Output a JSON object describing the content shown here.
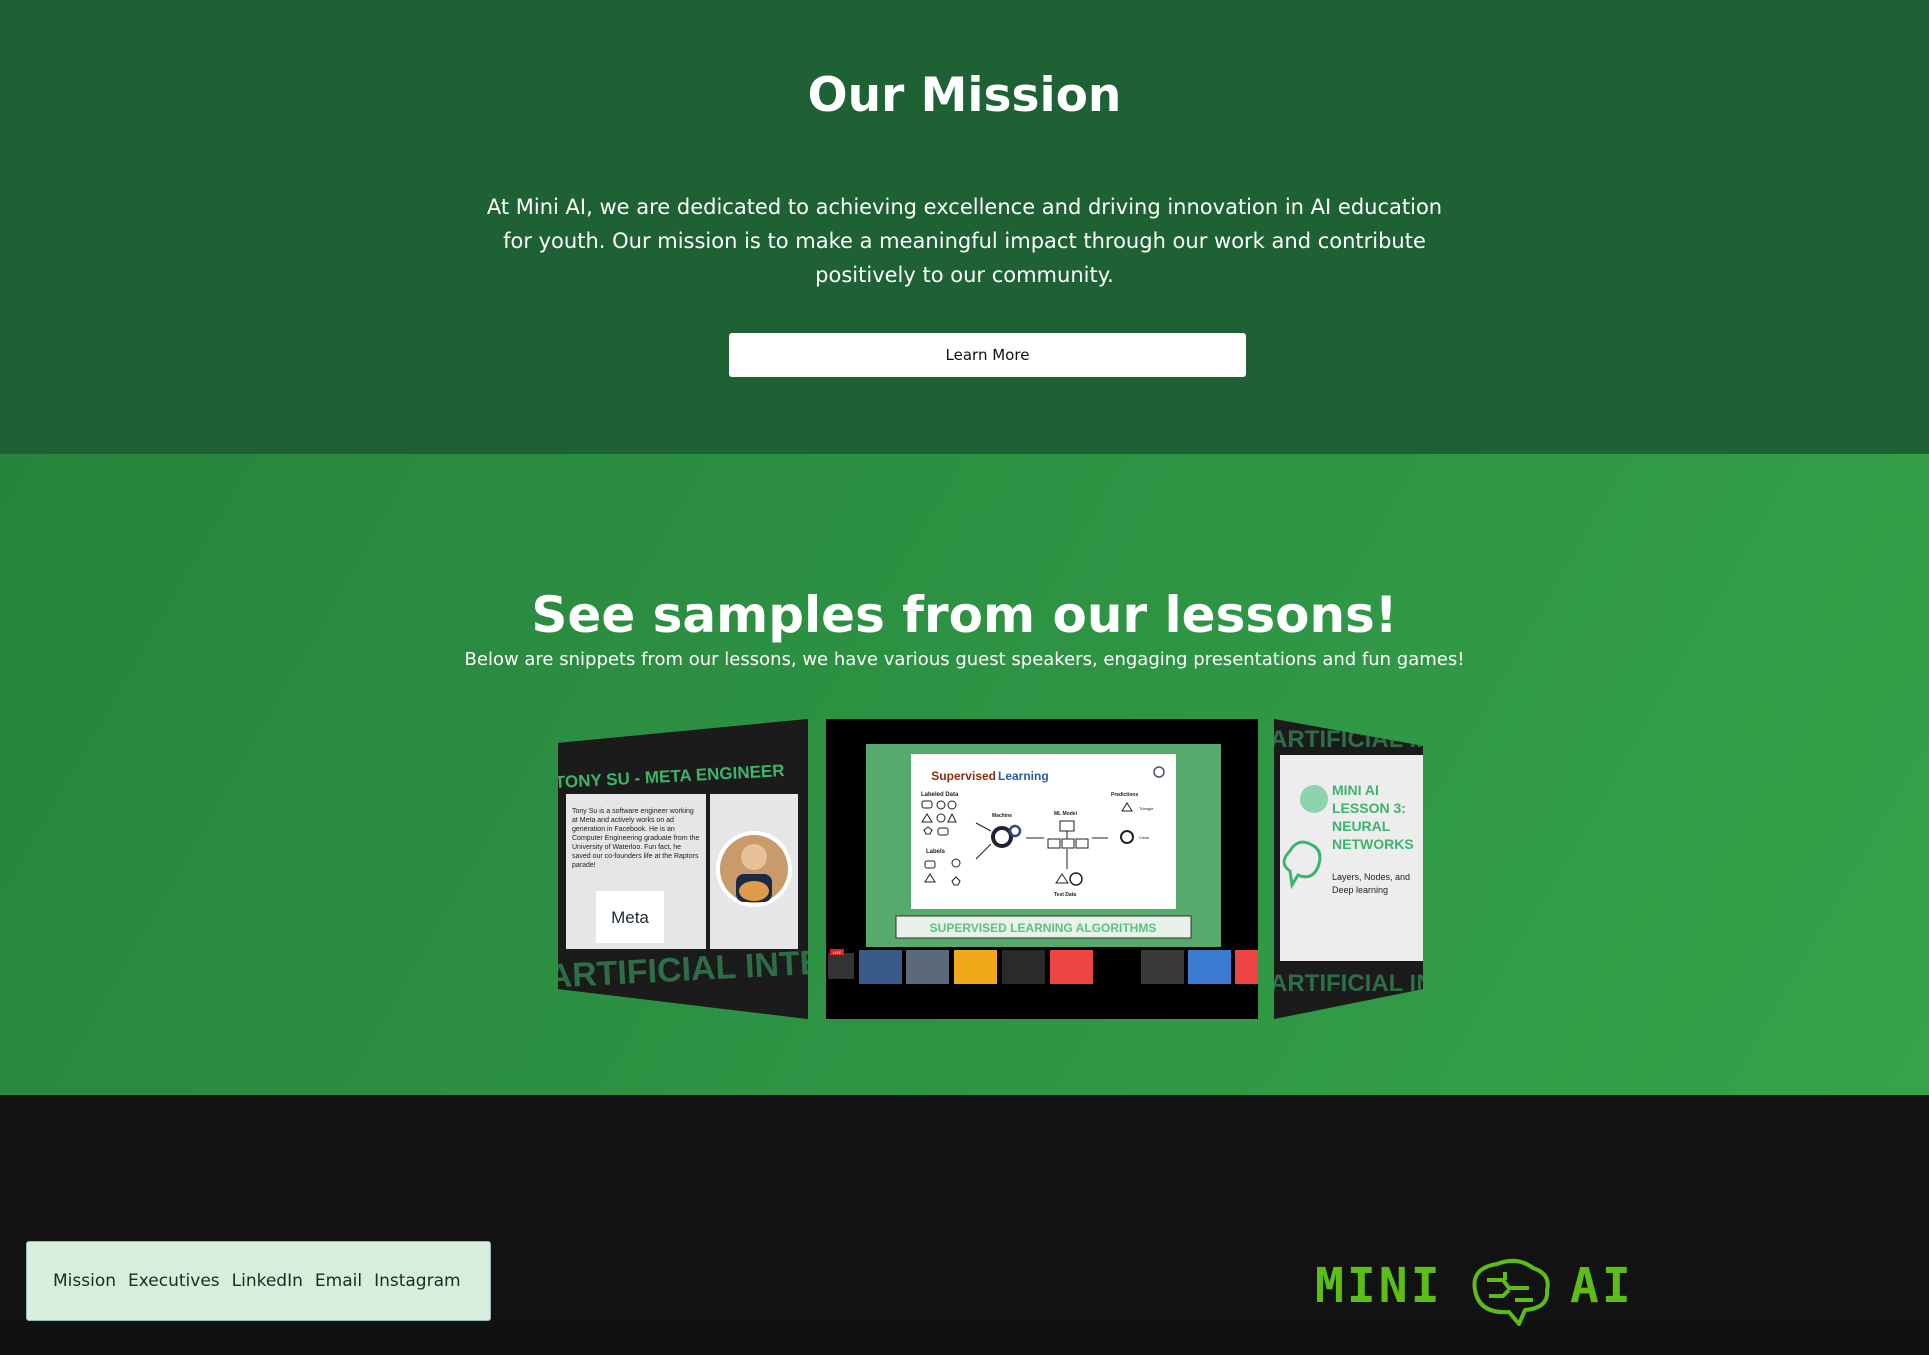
{
  "mission": {
    "title": "Our Mission",
    "paragraph": "At Mini AI, we are dedicated to achieving excellence and driving innovation in AI education for youth. Our mission is to make a meaningful impact through our work and contribute positively to our community.",
    "button_label": "Learn More"
  },
  "lessons": {
    "title": "See samples from our lessons!",
    "subtitle": "Below are snippets from our lessons, we have various guest speakers, engaging presentations and fun games!",
    "slides": {
      "left": {
        "heading": "TONY SU - META ENGINEER",
        "bio": "Tony Su is a software engineer working at Meta and actively works on ad generation in Facebook. He is an Computer Engineering graduate from the University of Waterloo. Fun fact, he saved our co-founders life at the Raptors parade!",
        "logo_text": "Meta",
        "background_text": "ARTIFICIAL INTELLIGENCE (A"
      },
      "center": {
        "slide_title_a": "Supervised ",
        "slide_title_b": "Learning",
        "labeled_data": "Labeled Data",
        "labels": "Labels",
        "machine": "Machine",
        "ml_model": "ML Model",
        "predictions": "Predictions",
        "test_data": "Test Data",
        "triangle": "Triangle",
        "circle": "Circle",
        "banner": "SUPERVISED LEARNING ALGORITHMS",
        "live_badge": "LIVE"
      },
      "right": {
        "heading": "MINI AI LESSON 3: NEURAL NETWORKS",
        "subheading": "Layers, Nodes, and Deep learning",
        "background_text": "ARTIFICIAL INTELLIGENCE (A"
      }
    }
  },
  "footer": {
    "nav": [
      "Mission",
      "Executives",
      "LinkedIn",
      "Email",
      "Instagram"
    ],
    "logo_left": "MINI",
    "logo_right": "AI",
    "logo_icon": "brain-icon"
  },
  "colors": {
    "mission_bg": "#1e6134",
    "lessons_bg": "#2f9645",
    "footer_bg": "#141414",
    "logo_green": "#5bbd16",
    "accent_green": "#3cb56a"
  }
}
